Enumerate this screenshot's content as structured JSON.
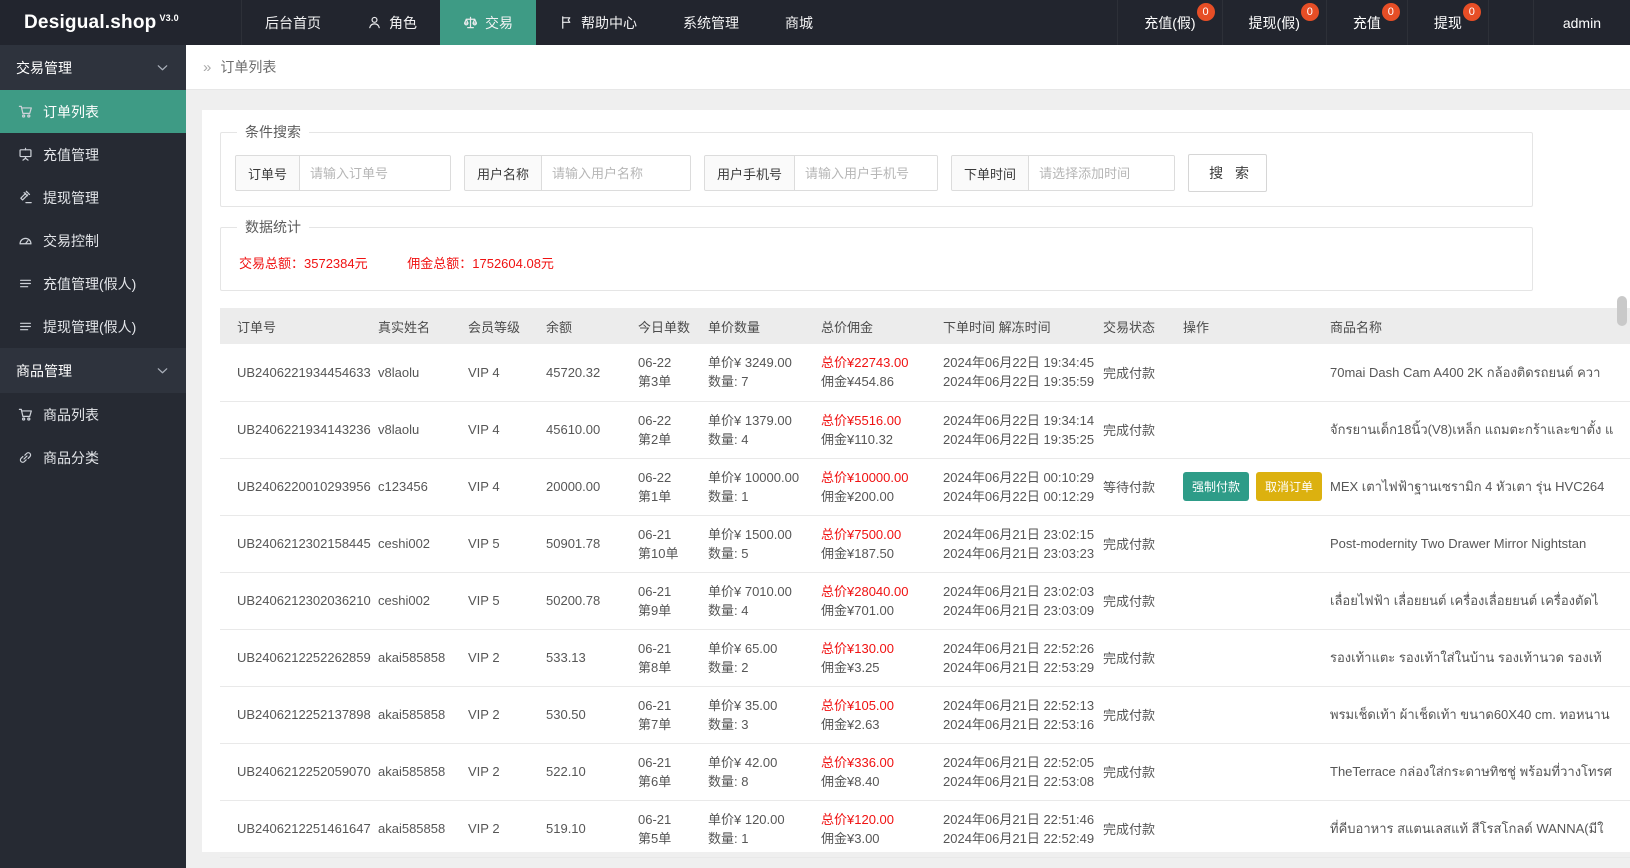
{
  "topbar": {
    "logo": "Desigual.shop",
    "logo_version": "V3.0",
    "nav": [
      {
        "label": "后台首页",
        "icon": null,
        "active": false
      },
      {
        "label": "角色",
        "icon": "user-icon",
        "active": false
      },
      {
        "label": "交易",
        "icon": "scale-icon",
        "active": true
      },
      {
        "label": "帮助中心",
        "icon": "flag-icon",
        "active": false
      },
      {
        "label": "系统管理",
        "icon": null,
        "active": false
      },
      {
        "label": "商城",
        "icon": null,
        "active": false
      }
    ],
    "quick": [
      {
        "label": "充值(假)",
        "badge": "0"
      },
      {
        "label": "提现(假)",
        "badge": "0"
      },
      {
        "label": "充值",
        "badge": "0"
      },
      {
        "label": "提现",
        "badge": "0"
      }
    ],
    "user": "admin"
  },
  "sidebar": {
    "groups": [
      {
        "label": "交易管理",
        "items": [
          {
            "label": "订单列表",
            "icon": "cart-icon",
            "active": true
          },
          {
            "label": "充值管理",
            "icon": "board-icon",
            "active": false
          },
          {
            "label": "提现管理",
            "icon": "gavel-icon",
            "active": false
          },
          {
            "label": "交易控制",
            "icon": "gauge-icon",
            "active": false
          },
          {
            "label": "充值管理(假人)",
            "icon": "list-icon",
            "active": false
          },
          {
            "label": "提现管理(假人)",
            "icon": "list-icon",
            "active": false
          }
        ]
      },
      {
        "label": "商品管理",
        "items": [
          {
            "label": "商品列表",
            "icon": "cart-icon",
            "active": false
          },
          {
            "label": "商品分类",
            "icon": "link-icon",
            "active": false
          }
        ]
      }
    ]
  },
  "breadcrumb": {
    "separator": "»",
    "title": "订单列表"
  },
  "search": {
    "legend": "条件搜索",
    "fields": [
      {
        "label": "订单号",
        "placeholder": "请输入订单号",
        "input_width": 150
      },
      {
        "label": "用户名称",
        "placeholder": "请输入用户名称",
        "input_width": 148
      },
      {
        "label": "用户手机号",
        "placeholder": "请输入用户手机号",
        "input_width": 142
      },
      {
        "label": "下单时间",
        "placeholder": "请选择添加时间",
        "input_width": 145
      }
    ],
    "button_label": "搜 索"
  },
  "stats": {
    "legend": "数据统计",
    "transaction_total": "交易总额：3572384元",
    "commission_total": "佣金总额：1752604.08元"
  },
  "table": {
    "columns": [
      "订单号",
      "真实姓名",
      "会员等级",
      "余额",
      "今日单数",
      "单价数量",
      "总价佣金",
      "下单时间 解冻时间",
      "交易状态",
      "操作",
      "商品名称"
    ],
    "cell_labels": {
      "unit": "单价¥",
      "qty": "数量:",
      "total": "总价¥",
      "commission": "佣金¥"
    },
    "rows": [
      {
        "order_no": "UB2406221934454633",
        "name": "v8laolu",
        "vip": "VIP 4",
        "balance": "45720.32",
        "day": "06-22",
        "seq": "第3单",
        "unit_price": "3249.00",
        "qty": "7",
        "total": "22743.00",
        "commission": "454.86",
        "time1": "2024年06月22日 19:34:45",
        "time2": "2024年06月22日 19:35:59",
        "status": "完成付款",
        "actions": [],
        "product": "70mai Dash Cam A400 2K กล้องติดรถยนต์ ควา"
      },
      {
        "order_no": "UB2406221934143236",
        "name": "v8laolu",
        "vip": "VIP 4",
        "balance": "45610.00",
        "day": "06-22",
        "seq": "第2单",
        "unit_price": "1379.00",
        "qty": "4",
        "total": "5516.00",
        "commission": "110.32",
        "time1": "2024年06月22日 19:34:14",
        "time2": "2024年06月22日 19:35:25",
        "status": "完成付款",
        "actions": [],
        "product": "จักรยานเด็ก18นิ้ว(V8)เหล็ก แถมตะกร้าและขาตั้ง แ"
      },
      {
        "order_no": "UB2406220010293956",
        "name": "c123456",
        "vip": "VIP 4",
        "balance": "20000.00",
        "day": "06-22",
        "seq": "第1单",
        "unit_price": "10000.00",
        "qty": "1",
        "total": "10000.00",
        "commission": "200.00",
        "time1": "2024年06月22日 00:10:29",
        "time2": "2024年06月22日 00:12:29",
        "status": "等待付款",
        "actions": [
          {
            "label": "强制付款",
            "color": "green"
          },
          {
            "label": "取消订单",
            "color": "yellow"
          }
        ],
        "product": "MEX เตาไฟฟ้าฐานเซรามิก 4 หัวเตา รุ่น HVC264"
      },
      {
        "order_no": "UB2406212302158445",
        "name": "ceshi002",
        "vip": "VIP 5",
        "balance": "50901.78",
        "day": "06-21",
        "seq": "第10单",
        "unit_price": "1500.00",
        "qty": "5",
        "total": "7500.00",
        "commission": "187.50",
        "time1": "2024年06月21日 23:02:15",
        "time2": "2024年06月21日 23:03:23",
        "status": "完成付款",
        "actions": [],
        "product": "Post-modernity Two Drawer Mirror Nightstan"
      },
      {
        "order_no": "UB2406212302036210",
        "name": "ceshi002",
        "vip": "VIP 5",
        "balance": "50200.78",
        "day": "06-21",
        "seq": "第9单",
        "unit_price": "7010.00",
        "qty": "4",
        "total": "28040.00",
        "commission": "701.00",
        "time1": "2024年06月21日 23:02:03",
        "time2": "2024年06月21日 23:03:09",
        "status": "完成付款",
        "actions": [],
        "product": "เลื่อยไฟฟ้า เลื่อยยนต์ เครื่องเลื่อยยนต์ เครื่องตัดไ"
      },
      {
        "order_no": "UB2406212252262859",
        "name": "akai585858",
        "vip": "VIP 2",
        "balance": "533.13",
        "day": "06-21",
        "seq": "第8单",
        "unit_price": "65.00",
        "qty": "2",
        "total": "130.00",
        "commission": "3.25",
        "time1": "2024年06月21日 22:52:26",
        "time2": "2024年06月21日 22:53:29",
        "status": "完成付款",
        "actions": [],
        "product": "รองเท้าแตะ รองเท้าใส่ในบ้าน รองเท้านวด รองเท้"
      },
      {
        "order_no": "UB2406212252137898",
        "name": "akai585858",
        "vip": "VIP 2",
        "balance": "530.50",
        "day": "06-21",
        "seq": "第7单",
        "unit_price": "35.00",
        "qty": "3",
        "total": "105.00",
        "commission": "2.63",
        "time1": "2024年06月21日 22:52:13",
        "time2": "2024年06月21日 22:53:16",
        "status": "完成付款",
        "actions": [],
        "product": "พรมเช็ดเท้า ผ้าเช็ดเท้า ขนาด60X40 cm. ทอหนาน"
      },
      {
        "order_no": "UB2406212252059070",
        "name": "akai585858",
        "vip": "VIP 2",
        "balance": "522.10",
        "day": "06-21",
        "seq": "第6单",
        "unit_price": "42.00",
        "qty": "8",
        "total": "336.00",
        "commission": "8.40",
        "time1": "2024年06月21日 22:52:05",
        "time2": "2024年06月21日 22:53:08",
        "status": "完成付款",
        "actions": [],
        "product": "TheTerrace กล่องใส่กระดาษทิชชู่ พร้อมที่วางโทรศ"
      },
      {
        "order_no": "UB2406212251461647",
        "name": "akai585858",
        "vip": "VIP 2",
        "balance": "519.10",
        "day": "06-21",
        "seq": "第5单",
        "unit_price": "120.00",
        "qty": "1",
        "total": "120.00",
        "commission": "3.00",
        "time1": "2024年06月21日 22:51:46",
        "time2": "2024年06月21日 22:52:49",
        "status": "完成付款",
        "actions": [],
        "product": "ที่คีบอาหาร สแตนเลสแท้ สีโรสโกลด์ WANNA(มีใ"
      }
    ]
  },
  "colors": {
    "topbar_bg": "#22252e",
    "sidebar_bg": "#262a33",
    "accent_green": "#3e9b85",
    "badge_red": "#e74e26",
    "danger_red": "#f01212",
    "btn_green": "#2e9c88",
    "btn_yellow": "#dcb10f"
  }
}
